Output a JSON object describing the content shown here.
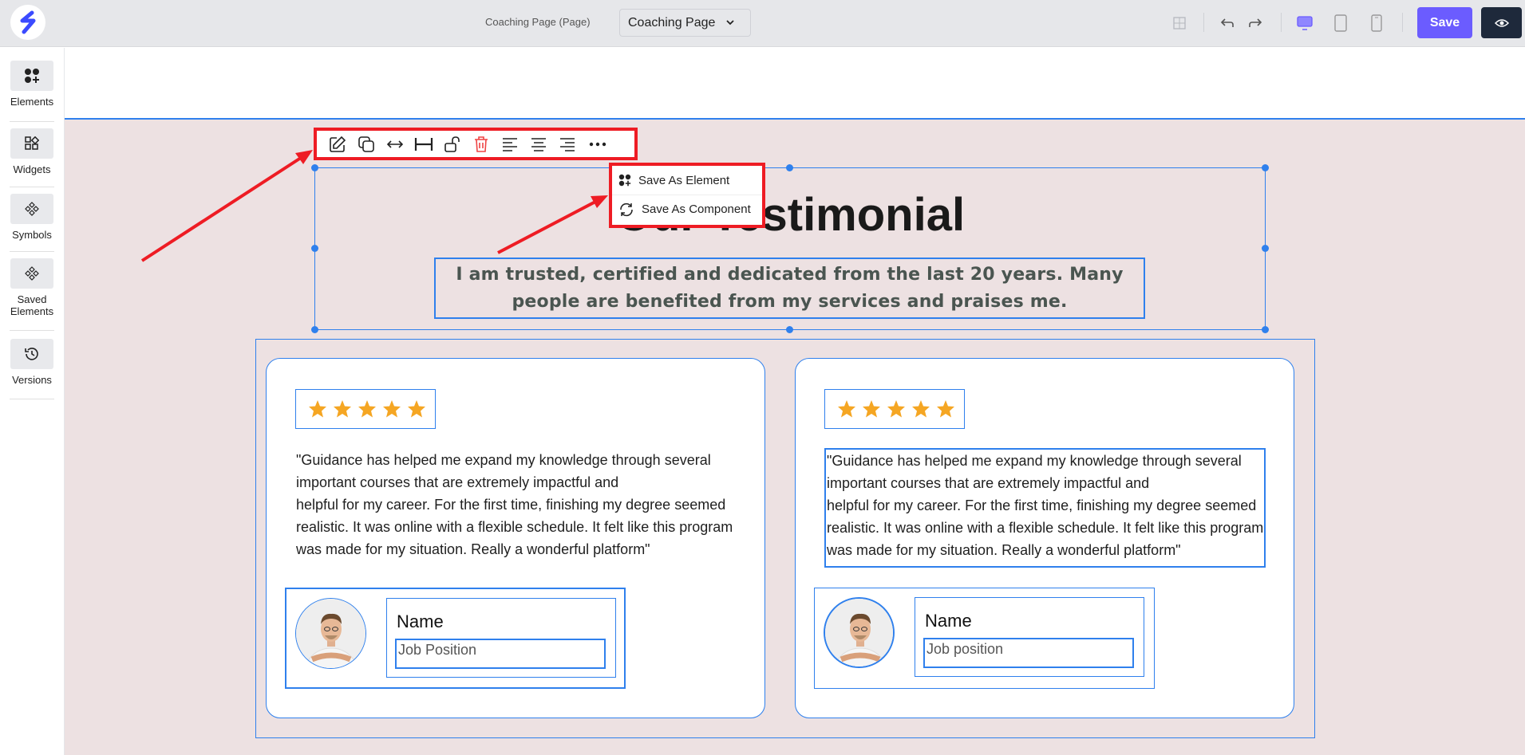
{
  "topbar": {
    "page_label": "Coaching Page (Page)",
    "page_select_value": "Coaching Page",
    "save_label": "Save"
  },
  "sidebar": {
    "items": [
      {
        "label": "Elements",
        "icon": "elements-icon"
      },
      {
        "label": "Widgets",
        "icon": "widgets-icon"
      },
      {
        "label": "Symbols",
        "icon": "symbols-icon"
      },
      {
        "label": "Saved Elements",
        "icon": "saved-elements-icon"
      },
      {
        "label": "Versions",
        "icon": "history-icon"
      }
    ]
  },
  "toolbar": {
    "buttons": [
      "edit-icon",
      "duplicate-icon",
      "width-icon",
      "full-width-icon",
      "unlock-icon",
      "delete-icon",
      "align-left-icon",
      "align-center-icon",
      "align-right-icon",
      "more-icon"
    ]
  },
  "dropdown": {
    "items": [
      "Save As Element",
      "Save As Component"
    ]
  },
  "section": {
    "heading": "Our Testimonial",
    "subheading": "I am trusted, certified and dedicated from the last 20 years. Many people are benefited from my services and praises me."
  },
  "cards": [
    {
      "rating": 5,
      "quote_lines": [
        "\"Guidance has helped me expand my knowledge through several",
        "important courses that are extremely impactful and",
        "helpful for my career. For the first time, finishing my degree seemed",
        "realistic. It was online with a flexible schedule. It felt like this program",
        "was made for my situation. Really a wonderful platform\""
      ],
      "name": "Name",
      "job": "Job Position"
    },
    {
      "rating": 5,
      "quote_lines": [
        "\"Guidance has helped me expand my knowledge through several",
        "important courses that are extremely impactful and",
        "helpful for my career. For the first time, finishing my degree seemed",
        "realistic. It was online with a flexible schedule. It felt like this program",
        "was made for my situation. Really a wonderful platform\""
      ],
      "name": "Name",
      "job": "Job position"
    }
  ],
  "colors": {
    "accent": "#6b5cff",
    "selection": "#2f80ed",
    "highlight": "#ee1c24",
    "star": "#f5a623",
    "canvas_bg": "#ede1e2"
  }
}
